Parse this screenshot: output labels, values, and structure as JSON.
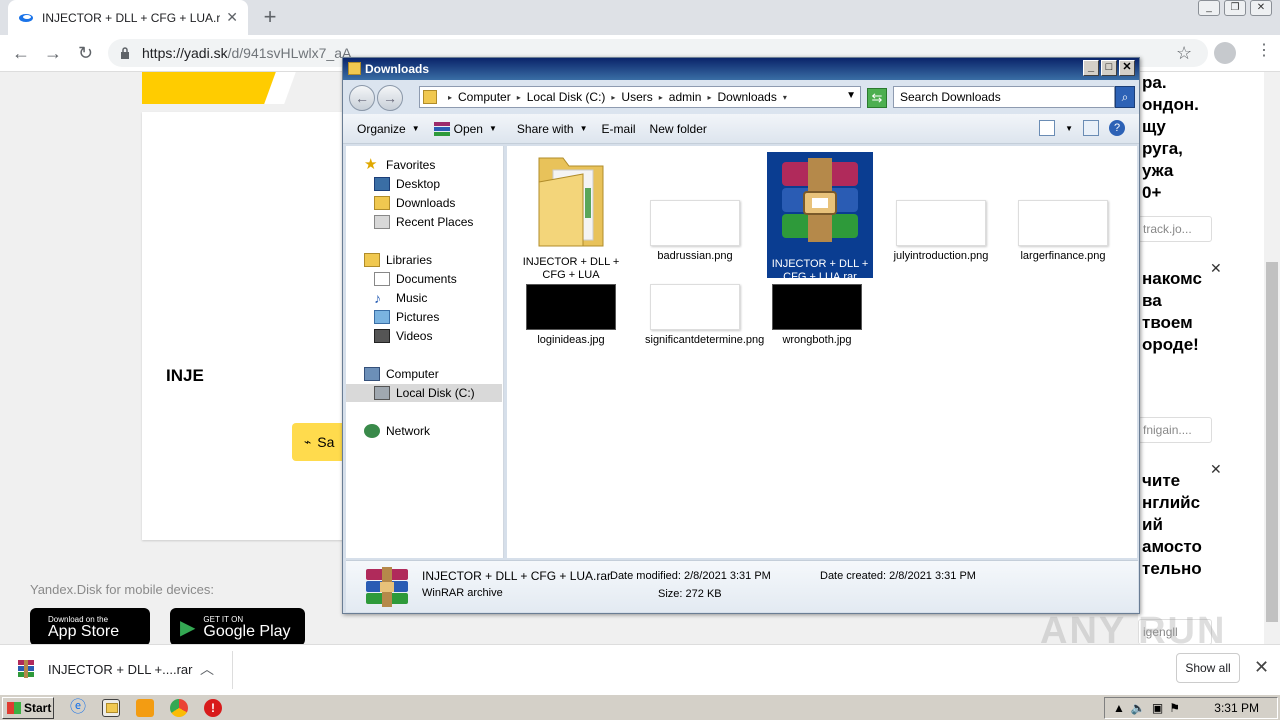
{
  "browser": {
    "tab_title": "INJECTOR + DLL + CFG + LUA.rar –",
    "url_main": "https://yadi.sk",
    "url_path": "/d/941svHLwlx7_aA",
    "new_tab_symbol": "+",
    "tab_close_symbol": "✕"
  },
  "page": {
    "card_title": "INJE",
    "save_button": "Sa",
    "mobile_label": "Yandex.Disk for mobile devices:",
    "app_store": {
      "small": "Download on the",
      "big": "App Store"
    },
    "google_play": {
      "small": "GET IT ON",
      "big": "Google Play"
    }
  },
  "ads": [
    {
      "text": "ра.\nондон.\nщу\nруга,\nужа\n0+",
      "link": "track.jo..."
    },
    {
      "text": "накомс\nва\n твоем\nороде!",
      "link": "fnigain...."
    },
    {
      "text": "чите\nнглийс\nий\nамосто\nтельно",
      "link": "igengll"
    }
  ],
  "explorer": {
    "title": "Downloads",
    "breadcrumb": [
      "Computer",
      "Local Disk (C:)",
      "Users",
      "admin",
      "Downloads"
    ],
    "search_placeholder": "Search Downloads",
    "toolbar": {
      "organize": "Organize",
      "open": "Open",
      "share_with": "Share with",
      "email": "E-mail",
      "new_folder": "New folder"
    },
    "nav": {
      "favorites": "Favorites",
      "desktop": "Desktop",
      "downloads": "Downloads",
      "recent_places": "Recent Places",
      "libraries": "Libraries",
      "documents": "Documents",
      "music": "Music",
      "pictures": "Pictures",
      "videos": "Videos",
      "computer": "Computer",
      "local_disk": "Local Disk (C:)",
      "network": "Network"
    },
    "files": [
      {
        "name": "INJECTOR + DLL + CFG + LUA",
        "type": "folder"
      },
      {
        "name": "badrussian.png",
        "type": "png"
      },
      {
        "name": "INJECTOR + DLL + CFG + LUA.rar",
        "type": "rar",
        "selected": true
      },
      {
        "name": "julyintroduction.png",
        "type": "png"
      },
      {
        "name": "largerfinance.png",
        "type": "png"
      },
      {
        "name": "loginideas.jpg",
        "type": "jpg-dark"
      },
      {
        "name": "significantdetermine.png",
        "type": "png-green"
      },
      {
        "name": "wrongboth.jpg",
        "type": "jpg-dark"
      }
    ],
    "details": {
      "filename": "INJECTOR + DLL + CFG + LUA.rar",
      "filetype": "WinRAR archive",
      "date_modified_label": "Date modified:",
      "date_modified": "2/8/2021 3:31 PM",
      "date_created_label": "Date created:",
      "date_created": "2/8/2021 3:31 PM",
      "size_label": "Size:",
      "size": "272 KB"
    }
  },
  "download_shelf": {
    "item": "INJECTOR + DLL +....rar",
    "show_all": "Show all"
  },
  "taskbar": {
    "start": "Start",
    "clock": "3:31 PM"
  },
  "watermark": "ANY RUN"
}
